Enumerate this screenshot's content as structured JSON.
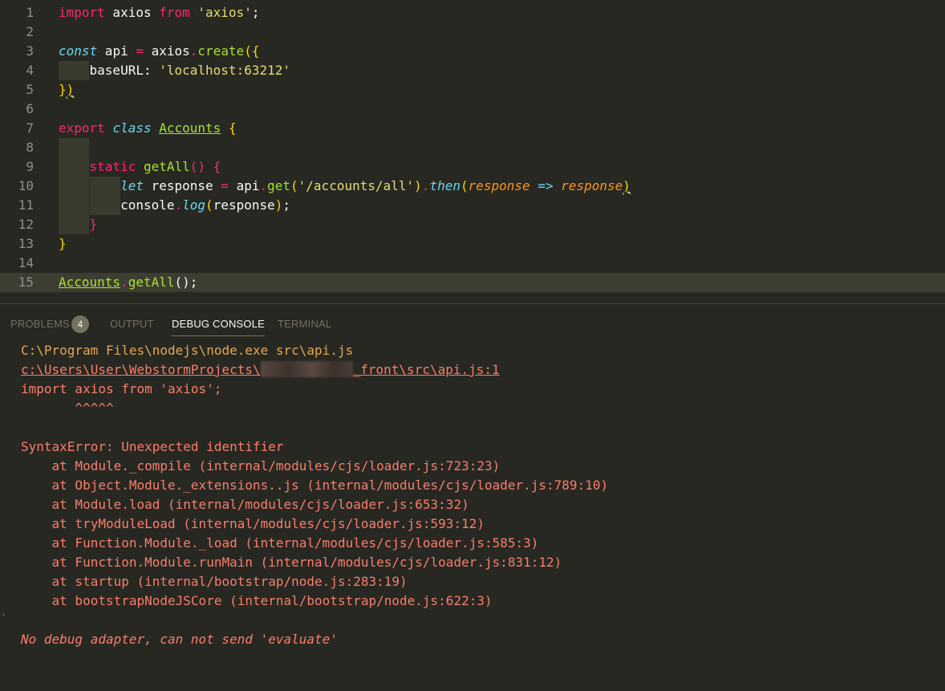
{
  "editor": {
    "lines": [
      {
        "num": "1",
        "tokens": [
          {
            "t": "import",
            "c": "kw"
          },
          {
            "t": " axios "
          },
          {
            "t": "from",
            "c": "kw"
          },
          {
            "t": " "
          },
          {
            "t": "'axios'",
            "c": "str"
          },
          {
            "t": ";"
          }
        ]
      },
      {
        "num": "2",
        "tokens": []
      },
      {
        "num": "3",
        "tokens": [
          {
            "t": "const",
            "c": "st"
          },
          {
            "t": " api "
          },
          {
            "t": "=",
            "c": "op"
          },
          {
            "t": " axios"
          },
          {
            "t": ".",
            "c": "op"
          },
          {
            "t": "create",
            "c": "fn"
          },
          {
            "t": "({",
            "c": "br"
          }
        ]
      },
      {
        "num": "4",
        "indent": 1,
        "tokens": [
          {
            "t": "    baseURL: "
          },
          {
            "t": "'localhost:63212'",
            "c": "str"
          }
        ]
      },
      {
        "num": "5",
        "tokens": [
          {
            "t": "}",
            "c": "br"
          },
          {
            "t": ")",
            "c": "br sq"
          }
        ]
      },
      {
        "num": "6",
        "tokens": []
      },
      {
        "num": "7",
        "tokens": [
          {
            "t": "export",
            "c": "kw"
          },
          {
            "t": " "
          },
          {
            "t": "class",
            "c": "st"
          },
          {
            "t": " "
          },
          {
            "t": "Accounts",
            "c": "cls"
          },
          {
            "t": " "
          },
          {
            "t": "{",
            "c": "br"
          }
        ]
      },
      {
        "num": "8",
        "indent": 1,
        "tokens": []
      },
      {
        "num": "9",
        "indent": 1,
        "tokens": [
          {
            "t": "    "
          },
          {
            "t": "static",
            "c": "kw"
          },
          {
            "t": " "
          },
          {
            "t": "getAll",
            "c": "fn"
          },
          {
            "t": "() {",
            "c": "kw"
          }
        ]
      },
      {
        "num": "10",
        "indent": 2,
        "tokens": [
          {
            "t": "        "
          },
          {
            "t": "let",
            "c": "st"
          },
          {
            "t": " response "
          },
          {
            "t": "=",
            "c": "op"
          },
          {
            "t": " api"
          },
          {
            "t": ".",
            "c": "op"
          },
          {
            "t": "get",
            "c": "fn"
          },
          {
            "t": "(",
            "c": "br"
          },
          {
            "t": "'/accounts/all'",
            "c": "str"
          },
          {
            "t": ")",
            "c": "br"
          },
          {
            "t": ".",
            "c": "op"
          },
          {
            "t": "then",
            "c": "st"
          },
          {
            "t": "(",
            "c": "br"
          },
          {
            "t": "response",
            "c": "par"
          },
          {
            "t": " "
          },
          {
            "t": "=>",
            "c": "st"
          },
          {
            "t": " "
          },
          {
            "t": "response",
            "c": "par"
          },
          {
            "t": ")",
            "c": "br sq"
          }
        ]
      },
      {
        "num": "11",
        "indent": 2,
        "tokens": [
          {
            "t": "        console"
          },
          {
            "t": ".",
            "c": "op"
          },
          {
            "t": "log",
            "c": "st"
          },
          {
            "t": "(",
            "c": "br"
          },
          {
            "t": "response"
          },
          {
            "t": ")",
            "c": "br"
          },
          {
            "t": ";"
          }
        ]
      },
      {
        "num": "12",
        "indent": 1,
        "tokens": [
          {
            "t": "    "
          },
          {
            "t": "}",
            "c": "kw"
          }
        ]
      },
      {
        "num": "13",
        "tokens": [
          {
            "t": "}",
            "c": "br"
          }
        ]
      },
      {
        "num": "14",
        "tokens": []
      },
      {
        "num": "15",
        "current": true,
        "tokens": [
          {
            "t": "Accounts",
            "c": "cls"
          },
          {
            "t": ".",
            "c": "op"
          },
          {
            "t": "getAll",
            "c": "fn"
          },
          {
            "t": "();"
          }
        ]
      }
    ]
  },
  "panel": {
    "tabs": {
      "problems": "PROBLEMS",
      "problems_count": "4",
      "output": "OUTPUT",
      "debug_console": "DEBUG CONSOLE",
      "terminal": "TERMINAL"
    },
    "console": {
      "command": "C:\\Program Files\\nodejs\\node.exe src\\api.js",
      "path_prefix": "c:\\Users\\User\\WebstormProjects\\",
      "path_suffix": "_front\\src\\api.js:1",
      "source_line": "import axios from 'axios';",
      "caret": "       ^^^^^",
      "error": "SyntaxError: Unexpected identifier",
      "stack": [
        "    at Module._compile (internal/modules/cjs/loader.js:723:23)",
        "    at Object.Module._extensions..js (internal/modules/cjs/loader.js:789:10)",
        "    at Module.load (internal/modules/cjs/loader.js:653:32)",
        "    at tryModuleLoad (internal/modules/cjs/loader.js:593:12)",
        "    at Function.Module._load (internal/modules/cjs/loader.js:585:3)",
        "    at Function.Module.runMain (internal/modules/cjs/loader.js:831:12)",
        "    at startup (internal/bootstrap/node.js:283:19)",
        "    at bootstrapNodeJSCore (internal/bootstrap/node.js:622:3)"
      ],
      "adapter_message": "No debug adapter, can not send 'evaluate'"
    }
  },
  "colors": {
    "background": "#272822",
    "keyword": "#f92672",
    "storage": "#66d9ef",
    "string": "#e6db74",
    "function": "#a6e22e",
    "parameter": "#fd971f",
    "bracket": "#ffd700",
    "console_error": "#f97d6b",
    "console_command": "#e5a657"
  }
}
